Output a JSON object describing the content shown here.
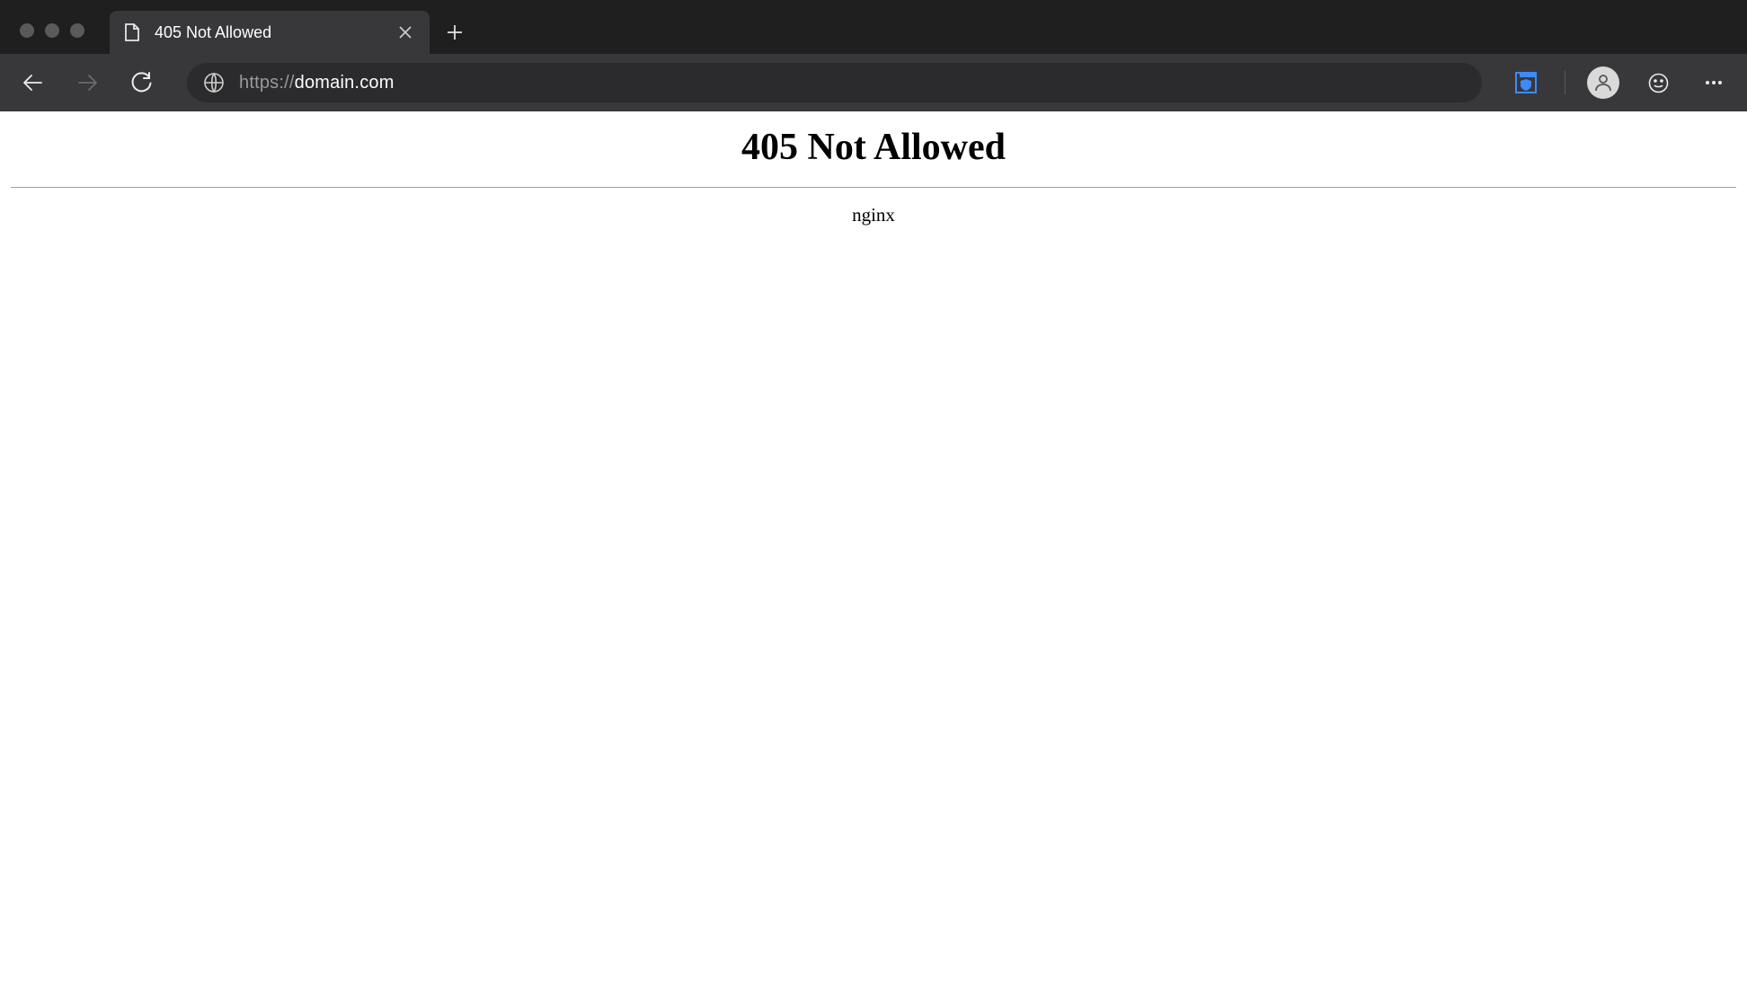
{
  "tab": {
    "title": "405 Not Allowed"
  },
  "address_bar": {
    "protocol": "https://",
    "host": "domain.com"
  },
  "page": {
    "heading": "405 Not Allowed",
    "server": "nginx"
  }
}
